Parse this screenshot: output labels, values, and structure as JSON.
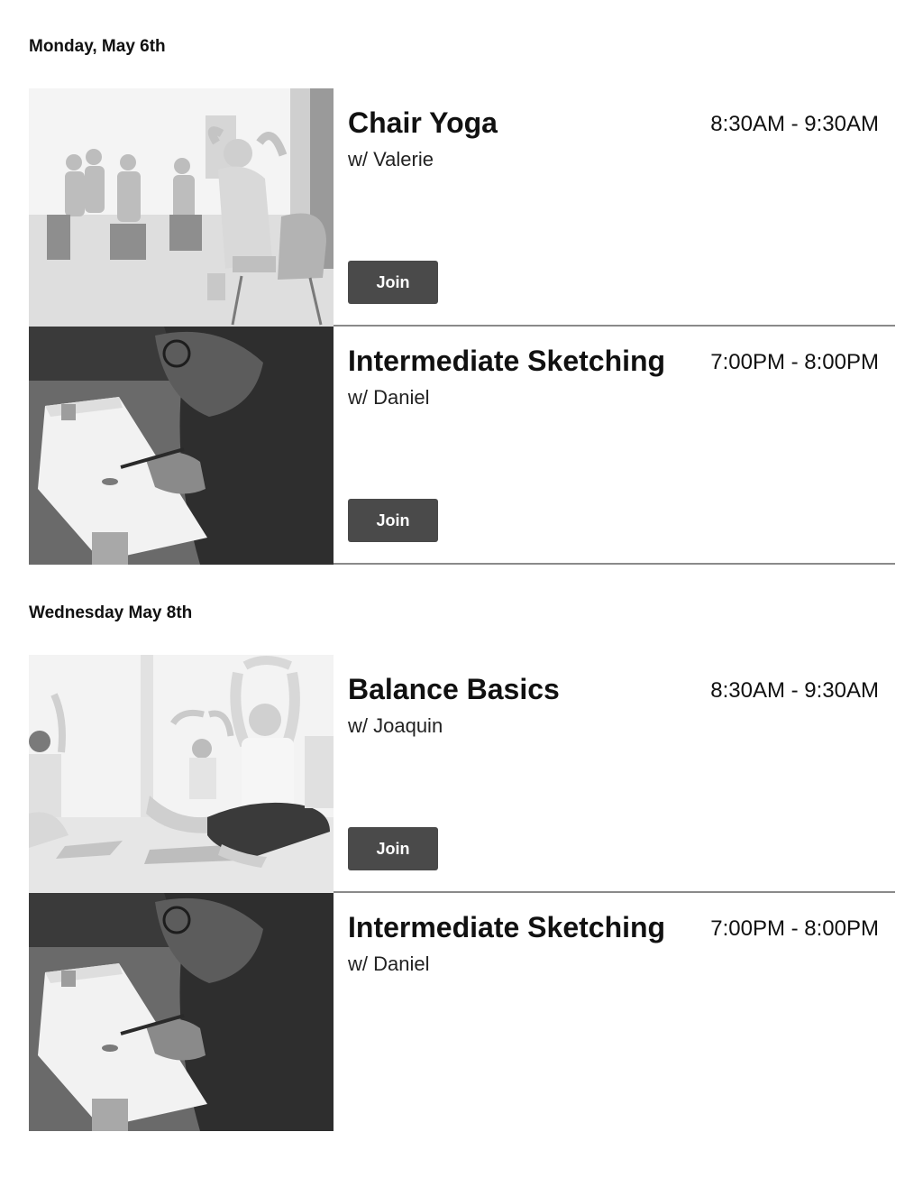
{
  "days": [
    {
      "label": "Monday, May 6th",
      "classes": [
        {
          "title": "Chair Yoga",
          "instructor": "w/ Valerie",
          "time": "8:30AM - 9:30AM",
          "image": "chair-yoga-photo",
          "join_label": "Join"
        },
        {
          "title": "Intermediate Sketching",
          "instructor": "w/ Daniel",
          "time": "7:00PM - 8:00PM",
          "image": "sketching-photo",
          "join_label": "Join"
        }
      ]
    },
    {
      "label": "Wednesday May 8th",
      "classes": [
        {
          "title": "Balance Basics",
          "instructor": "w/ Joaquin",
          "time": "8:30AM - 9:30AM",
          "image": "balance-basics-photo",
          "join_label": "Join"
        },
        {
          "title": "Intermediate Sketching",
          "instructor": "w/ Daniel",
          "time": "7:00PM - 8:00PM",
          "image": "sketching-photo"
        }
      ]
    }
  ],
  "colors": {
    "button_bg": "#4a4a4a",
    "divider": "#8a8a8a",
    "text": "#111111"
  }
}
